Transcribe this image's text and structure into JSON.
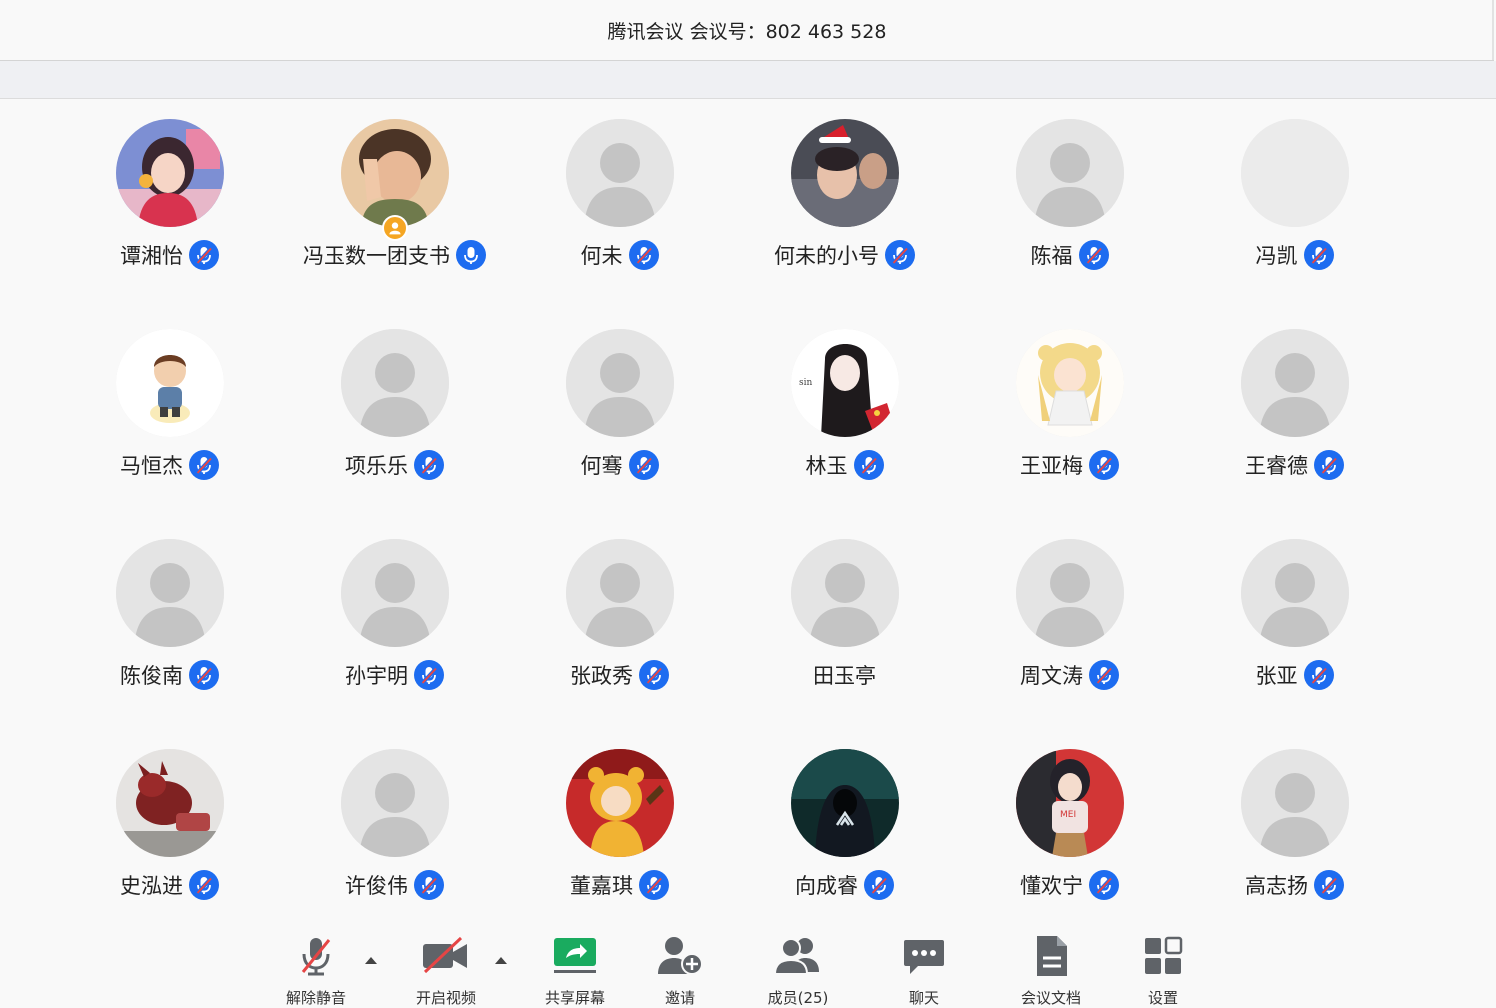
{
  "window": {
    "title": "腾讯会议 会议号：802 463 528"
  },
  "participants": [
    {
      "name": "谭湘怡",
      "mic": "muted",
      "avatar": "photo-girl-pink"
    },
    {
      "name": "冯玉数一团支书",
      "mic": "active",
      "avatar": "photo-boy-hand",
      "host": true
    },
    {
      "name": "何未",
      "mic": "muted",
      "avatar": "default"
    },
    {
      "name": "何未的小号",
      "mic": "muted",
      "avatar": "photo-santa-hat"
    },
    {
      "name": "陈福",
      "mic": "muted",
      "avatar": "default"
    },
    {
      "name": "冯凯",
      "mic": "muted",
      "avatar": "blank"
    },
    {
      "name": "马恒杰",
      "mic": "muted",
      "avatar": "cartoon-boy"
    },
    {
      "name": "项乐乐",
      "mic": "muted",
      "avatar": "default"
    },
    {
      "name": "何骞",
      "mic": "muted",
      "avatar": "default"
    },
    {
      "name": "林玉",
      "mic": "muted",
      "avatar": "anime-girl-dark"
    },
    {
      "name": "王亚梅",
      "mic": "muted",
      "avatar": "cartoon-blonde-girl"
    },
    {
      "name": "王睿德",
      "mic": "muted",
      "avatar": "default"
    },
    {
      "name": "陈俊南",
      "mic": "muted",
      "avatar": "default"
    },
    {
      "name": "孙宇明",
      "mic": "muted",
      "avatar": "default"
    },
    {
      "name": "张政秀",
      "mic": "muted",
      "avatar": "default"
    },
    {
      "name": "田玉亭",
      "mic": "none",
      "avatar": "default"
    },
    {
      "name": "周文涛",
      "mic": "muted",
      "avatar": "default"
    },
    {
      "name": "张亚",
      "mic": "muted",
      "avatar": "default"
    },
    {
      "name": "史泓进",
      "mic": "muted",
      "avatar": "photo-red-figure"
    },
    {
      "name": "许俊伟",
      "mic": "muted",
      "avatar": "default"
    },
    {
      "name": "董嘉琪",
      "mic": "muted",
      "avatar": "cartoon-bear-costume"
    },
    {
      "name": "向成睿",
      "mic": "muted",
      "avatar": "photo-hooded-man"
    },
    {
      "name": "懂欢宁",
      "mic": "muted",
      "avatar": "anime-girl-red"
    },
    {
      "name": "高志扬",
      "mic": "muted",
      "avatar": "default"
    }
  ],
  "toolbar": [
    {
      "label": "解除静音",
      "icon": "mic-muted-icon",
      "caret": true
    },
    {
      "label": "开启视频",
      "icon": "video-off-icon",
      "caret": true
    },
    {
      "label": "共享屏幕",
      "icon": "share-screen-icon"
    },
    {
      "label": "邀请",
      "icon": "invite-icon"
    },
    {
      "label": "成员(25)",
      "icon": "members-icon"
    },
    {
      "label": "聊天",
      "icon": "chat-icon"
    },
    {
      "label": "会议文档",
      "icon": "document-icon"
    },
    {
      "label": "设置",
      "icon": "settings-grid-icon"
    }
  ],
  "colors": {
    "accent": "#1d6cf0",
    "share_green": "#1aab5f",
    "muted_red": "#e64545",
    "icon_gray": "#5f6368"
  }
}
